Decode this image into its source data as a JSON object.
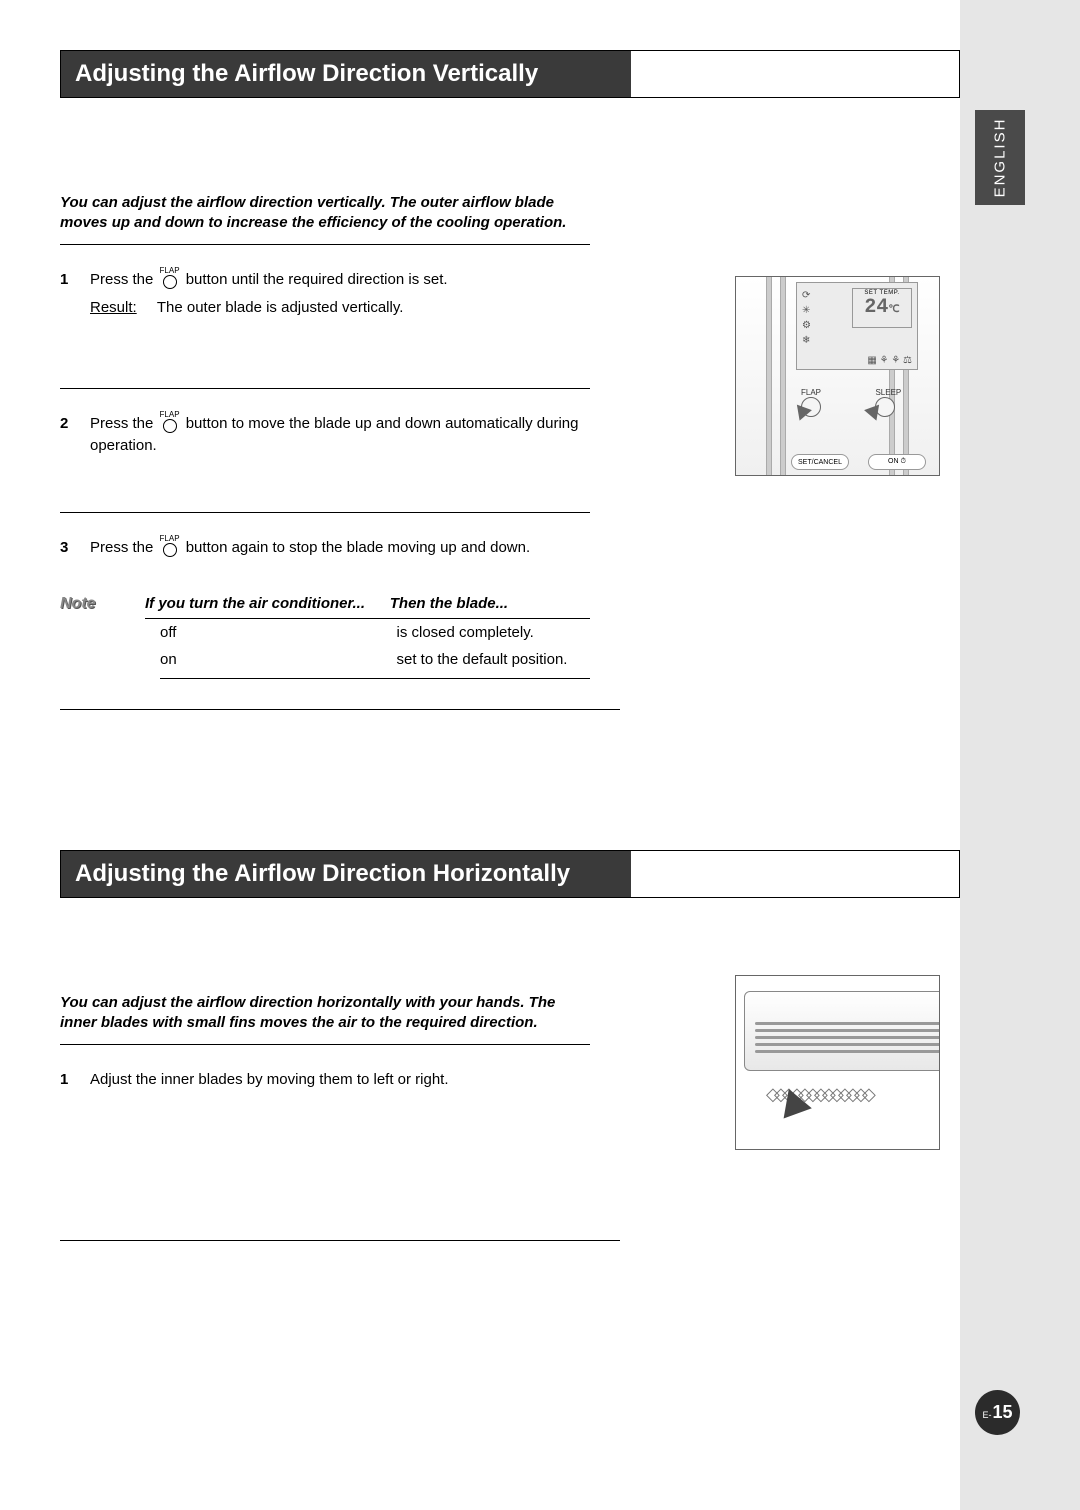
{
  "language_tab": "ENGLISH",
  "page_number_prefix": "E-",
  "page_number": "15",
  "flap_button_label": "FLAP",
  "section1": {
    "title": "Adjusting the Airflow Direction Vertically",
    "intro": "You can adjust the airflow direction vertically. The outer airflow blade moves up and down to increase the efficiency of the cooling operation.",
    "steps": [
      {
        "n": "1",
        "text_a": "Press the ",
        "text_b": " button until the required direction is set.",
        "result_label": "Result:",
        "result_text": "The outer blade is adjusted vertically."
      },
      {
        "n": "2",
        "text_a": "Press the ",
        "text_b": " button to move the blade up and down automatically during operation."
      },
      {
        "n": "3",
        "text_a": "Press the ",
        "text_b": " button again to stop the blade moving up and down."
      }
    ],
    "note_label": "Note",
    "note_table": {
      "col1": "If you turn the air conditioner...",
      "col2": "Then the blade...",
      "rows": [
        {
          "c1": "off",
          "c2": "is closed completely."
        },
        {
          "c1": "on",
          "c2": "set to the default position."
        }
      ]
    }
  },
  "section2": {
    "title": "Adjusting the Airflow Direction Horizontally",
    "intro": "You can adjust the airflow direction horizontally with your hands. The inner blades with small fins moves the air to the required direction.",
    "steps": [
      {
        "n": "1",
        "text": "Adjust the inner blades by moving them to left or right."
      }
    ]
  },
  "remote": {
    "set_temp_label": "SET TEMP.",
    "temp_value": "24",
    "temp_unit": "℃",
    "btn_flap": "FLAP",
    "btn_sleep": "SLEEP",
    "btn_set_cancel": "SET/CANCEL",
    "btn_on": "ON ⏱"
  }
}
